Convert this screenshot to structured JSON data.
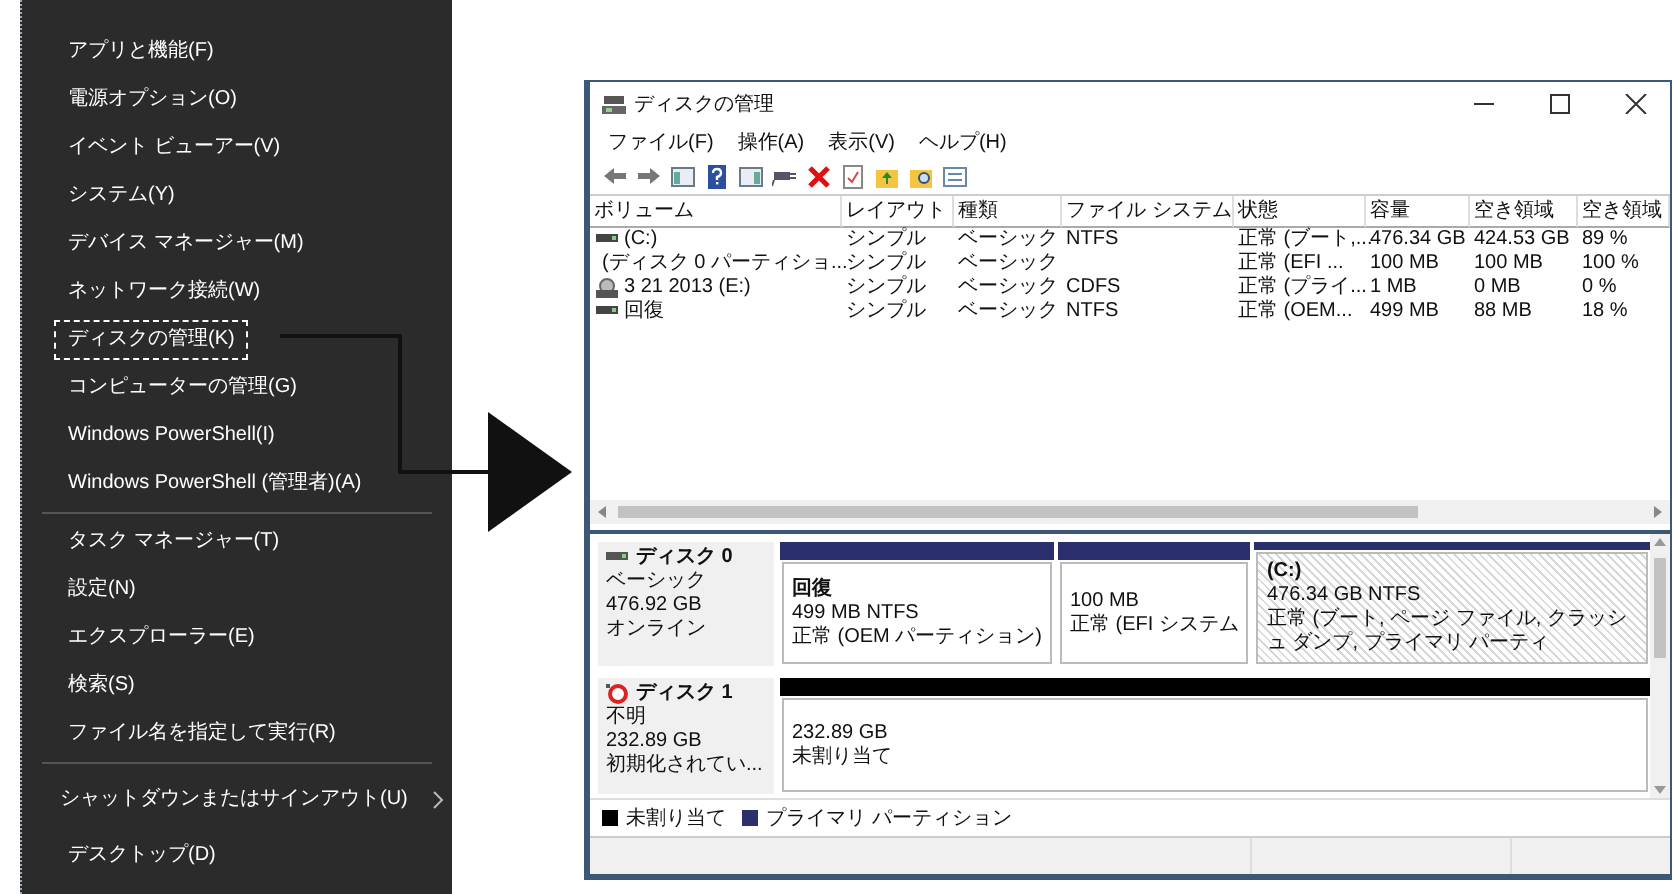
{
  "context_menu": {
    "groups": [
      {
        "items": [
          {
            "label": "アプリと機能(F)",
            "highlighted": false,
            "has_submenu": false
          },
          {
            "label": "電源オプション(O)",
            "highlighted": false,
            "has_submenu": false
          },
          {
            "label": "イベント ビューアー(V)",
            "highlighted": false,
            "has_submenu": false
          },
          {
            "label": "システム(Y)",
            "highlighted": false,
            "has_submenu": false
          },
          {
            "label": "デバイス マネージャー(M)",
            "highlighted": false,
            "has_submenu": false
          },
          {
            "label": "ネットワーク接続(W)",
            "highlighted": false,
            "has_submenu": false
          },
          {
            "label": "ディスクの管理(K)",
            "highlighted": true,
            "has_submenu": false
          },
          {
            "label": "コンピューターの管理(G)",
            "highlighted": false,
            "has_submenu": false
          },
          {
            "label": "Windows PowerShell(I)",
            "highlighted": false,
            "has_submenu": false
          },
          {
            "label": "Windows PowerShell (管理者)(A)",
            "highlighted": false,
            "has_submenu": false
          }
        ]
      },
      {
        "items": [
          {
            "label": "タスク マネージャー(T)",
            "highlighted": false,
            "has_submenu": false
          },
          {
            "label": "設定(N)",
            "highlighted": false,
            "has_submenu": false
          },
          {
            "label": "エクスプローラー(E)",
            "highlighted": false,
            "has_submenu": false
          },
          {
            "label": "検索(S)",
            "highlighted": false,
            "has_submenu": false
          },
          {
            "label": "ファイル名を指定して実行(R)",
            "highlighted": false,
            "has_submenu": false
          }
        ]
      },
      {
        "items": [
          {
            "label": "シャットダウンまたはサインアウト(U)",
            "highlighted": false,
            "has_submenu": true
          },
          {
            "label": "デスクトップ(D)",
            "highlighted": false,
            "has_submenu": false
          }
        ]
      }
    ]
  },
  "window": {
    "title": "ディスクの管理",
    "menu_bar": [
      "ファイル(F)",
      "操作(A)",
      "表示(V)",
      "ヘルプ(H)"
    ],
    "table": {
      "columns": [
        "ボリューム",
        "レイアウト",
        "種類",
        "ファイル システム",
        "状態",
        "容量",
        "空き領域",
        "空き領域"
      ],
      "rows": [
        {
          "kind": "drive",
          "cells": [
            "(C:)",
            "シンプル",
            "ベーシック",
            "NTFS",
            "正常 (ブート,...",
            "476.34 GB",
            "424.53 GB",
            "89 %"
          ]
        },
        {
          "kind": "drive",
          "cells": [
            "(ディスク 0 パーティショ...",
            "シンプル",
            "ベーシック",
            null,
            "正常 (EFI ...",
            "100 MB",
            "100 MB",
            "100 %"
          ]
        },
        {
          "kind": "cd",
          "cells": [
            "3 21 2013 (E:)",
            "シンプル",
            "ベーシック",
            "CDFS",
            "正常 (プライ...",
            "1 MB",
            "0 MB",
            "0 %"
          ]
        },
        {
          "kind": "drive",
          "cells": [
            "回復",
            "シンプル",
            "ベーシック",
            "NTFS",
            "正常 (OEM...",
            "499 MB",
            "88 MB",
            "18 %"
          ]
        }
      ]
    },
    "disks": [
      {
        "kind": "online",
        "name": "ディスク 0",
        "type": "ベーシック",
        "size": "476.92 GB",
        "status": "オンライン",
        "partitions": [
          {
            "label": "回復",
            "size": "499 MB NTFS",
            "status": "正常 (OEM パーティション)",
            "color": "#2b2f6b",
            "selected": false
          },
          {
            "size": "100 MB",
            "status": "正常 (EFI システム",
            "color": "#2b2f6b",
            "selected": false
          },
          {
            "label": "(C:)",
            "size": "476.34 GB NTFS",
            "status": "正常 (ブート, ページ ファイル, クラッシュ ダンプ, プライマリ パーティ",
            "color": "#2b2f6b",
            "selected": true
          }
        ]
      },
      {
        "kind": "unknown",
        "name": "ディスク 1",
        "type": "不明",
        "size": "232.89 GB",
        "status": "初期化されてい...",
        "partitions": [
          {
            "size": "232.89 GB",
            "status": "未割り当て",
            "color": "#000000",
            "selected": false
          }
        ]
      }
    ],
    "legend": [
      {
        "label": "未割り当て",
        "color": "#000000"
      },
      {
        "label": "プライマリ パーティション",
        "color": "#2b2f6b"
      }
    ]
  }
}
